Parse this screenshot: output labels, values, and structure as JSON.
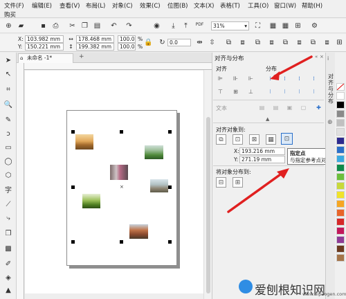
{
  "menu": {
    "row1": [
      "文件(F)",
      "编辑(E)",
      "查看(V)",
      "布局(L)",
      "对象(C)",
      "效果(C)",
      "位图(B)",
      "文本(X)",
      "表格(T)",
      "工具(O)",
      "窗口(W)",
      "帮助(H)"
    ],
    "row2": "购买"
  },
  "toolbar": {
    "zoom_value": "31%",
    "pdf_label": "PDF"
  },
  "property_bar": {
    "x_label": "X:",
    "x_value": "103.982 mm",
    "y_label": "Y:",
    "y_value": "150.221 mm",
    "w_value": "178.468 mm",
    "h_value": "199.382 mm",
    "scale_x": "100.0",
    "scale_y": "100.0",
    "pct": "%",
    "angle": "0.0"
  },
  "document": {
    "tab_name": "未命名 -1*",
    "add_tab": "+"
  },
  "panel": {
    "title": "对齐与分布",
    "align_label": "对齐",
    "distribute_label": "分布",
    "text_label": "文本",
    "align_to_label": "对齐对象到:",
    "coord_x_label": "X:",
    "coord_x_value": "193.216 mm",
    "coord_y_label": "Y:",
    "coord_y_value": "271.19 mm",
    "distribute_to_label": "将对象分布到:"
  },
  "tooltip": {
    "title": "指定点",
    "body": "与指定参考点对齐."
  },
  "side_tab": {
    "label": "对齐与分布"
  },
  "palette": {
    "colors": [
      "#ffffff",
      "#000000",
      "#8a8a8a",
      "#c0c0c0",
      "#e0e0e0",
      "#2d2a8f",
      "#2a6fc9",
      "#39a9e1",
      "#0e8a4a",
      "#6cbf3c",
      "#c8d93a",
      "#f1e32a",
      "#f6a623",
      "#e8652a",
      "#d62828",
      "#c2185b",
      "#8e3b96",
      "#6b3a1f",
      "#a5754a"
    ]
  },
  "watermark": {
    "text": "爱刨根知识网",
    "url": "www.aipaogen.com"
  }
}
